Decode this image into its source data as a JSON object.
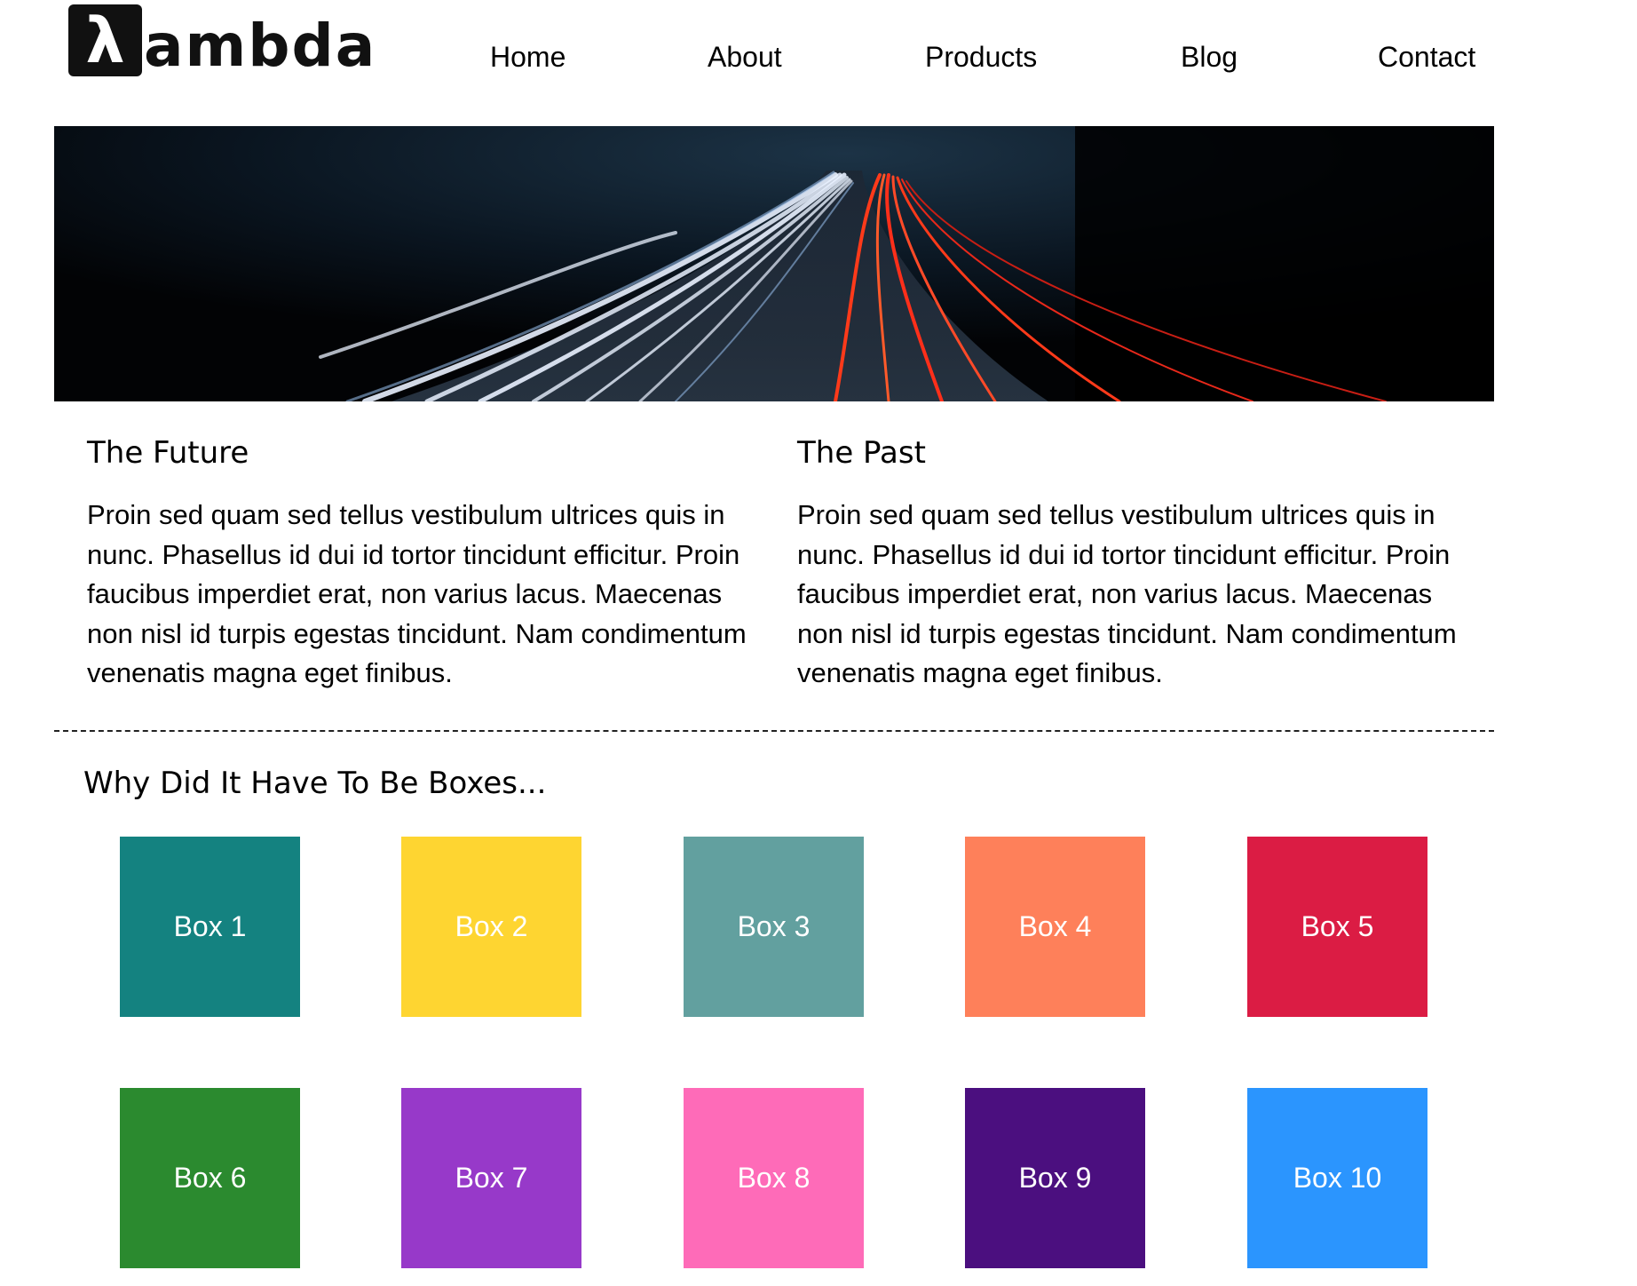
{
  "logo": {
    "mark": "λ",
    "text": "ambda"
  },
  "nav": [
    "Home",
    "About",
    "Products",
    "Blog",
    "Contact"
  ],
  "hero": {
    "description": ""
  },
  "columns": [
    {
      "title": "The Future",
      "body": "Proin sed quam sed tellus vestibulum ultrices quis in nunc. Phasellus id dui id tortor tincidunt efficitur. Proin faucibus imperdiet erat, non varius lacus. Maecenas non nisl id turpis egestas tincidunt. Nam condimentum venenatis magna eget finibus."
    },
    {
      "title": "The Past",
      "body": "Proin sed quam sed tellus vestibulum ultrices quis in nunc. Phasellus id dui id tortor tincidunt efficitur. Proin faucibus imperdiet erat, non varius lacus. Maecenas non nisl id turpis egestas tincidunt. Nam condimentum venenatis magna eget finibus."
    }
  ],
  "boxes_title": "Why Did It Have To Be Boxes...",
  "boxes": [
    {
      "label": "Box 1",
      "color": "#148280"
    },
    {
      "label": "Box 2",
      "color": "#fed531"
    },
    {
      "label": "Box 3",
      "color": "#62a09f"
    },
    {
      "label": "Box 4",
      "color": "#fe805a"
    },
    {
      "label": "Box 5",
      "color": "#db1c44"
    },
    {
      "label": "Box 6",
      "color": "#2b8a2f"
    },
    {
      "label": "Box 7",
      "color": "#9739c9"
    },
    {
      "label": "Box 8",
      "color": "#fe6bb8"
    },
    {
      "label": "Box 9",
      "color": "#4b0f7f"
    },
    {
      "label": "Box 10",
      "color": "#2b95fe"
    }
  ]
}
